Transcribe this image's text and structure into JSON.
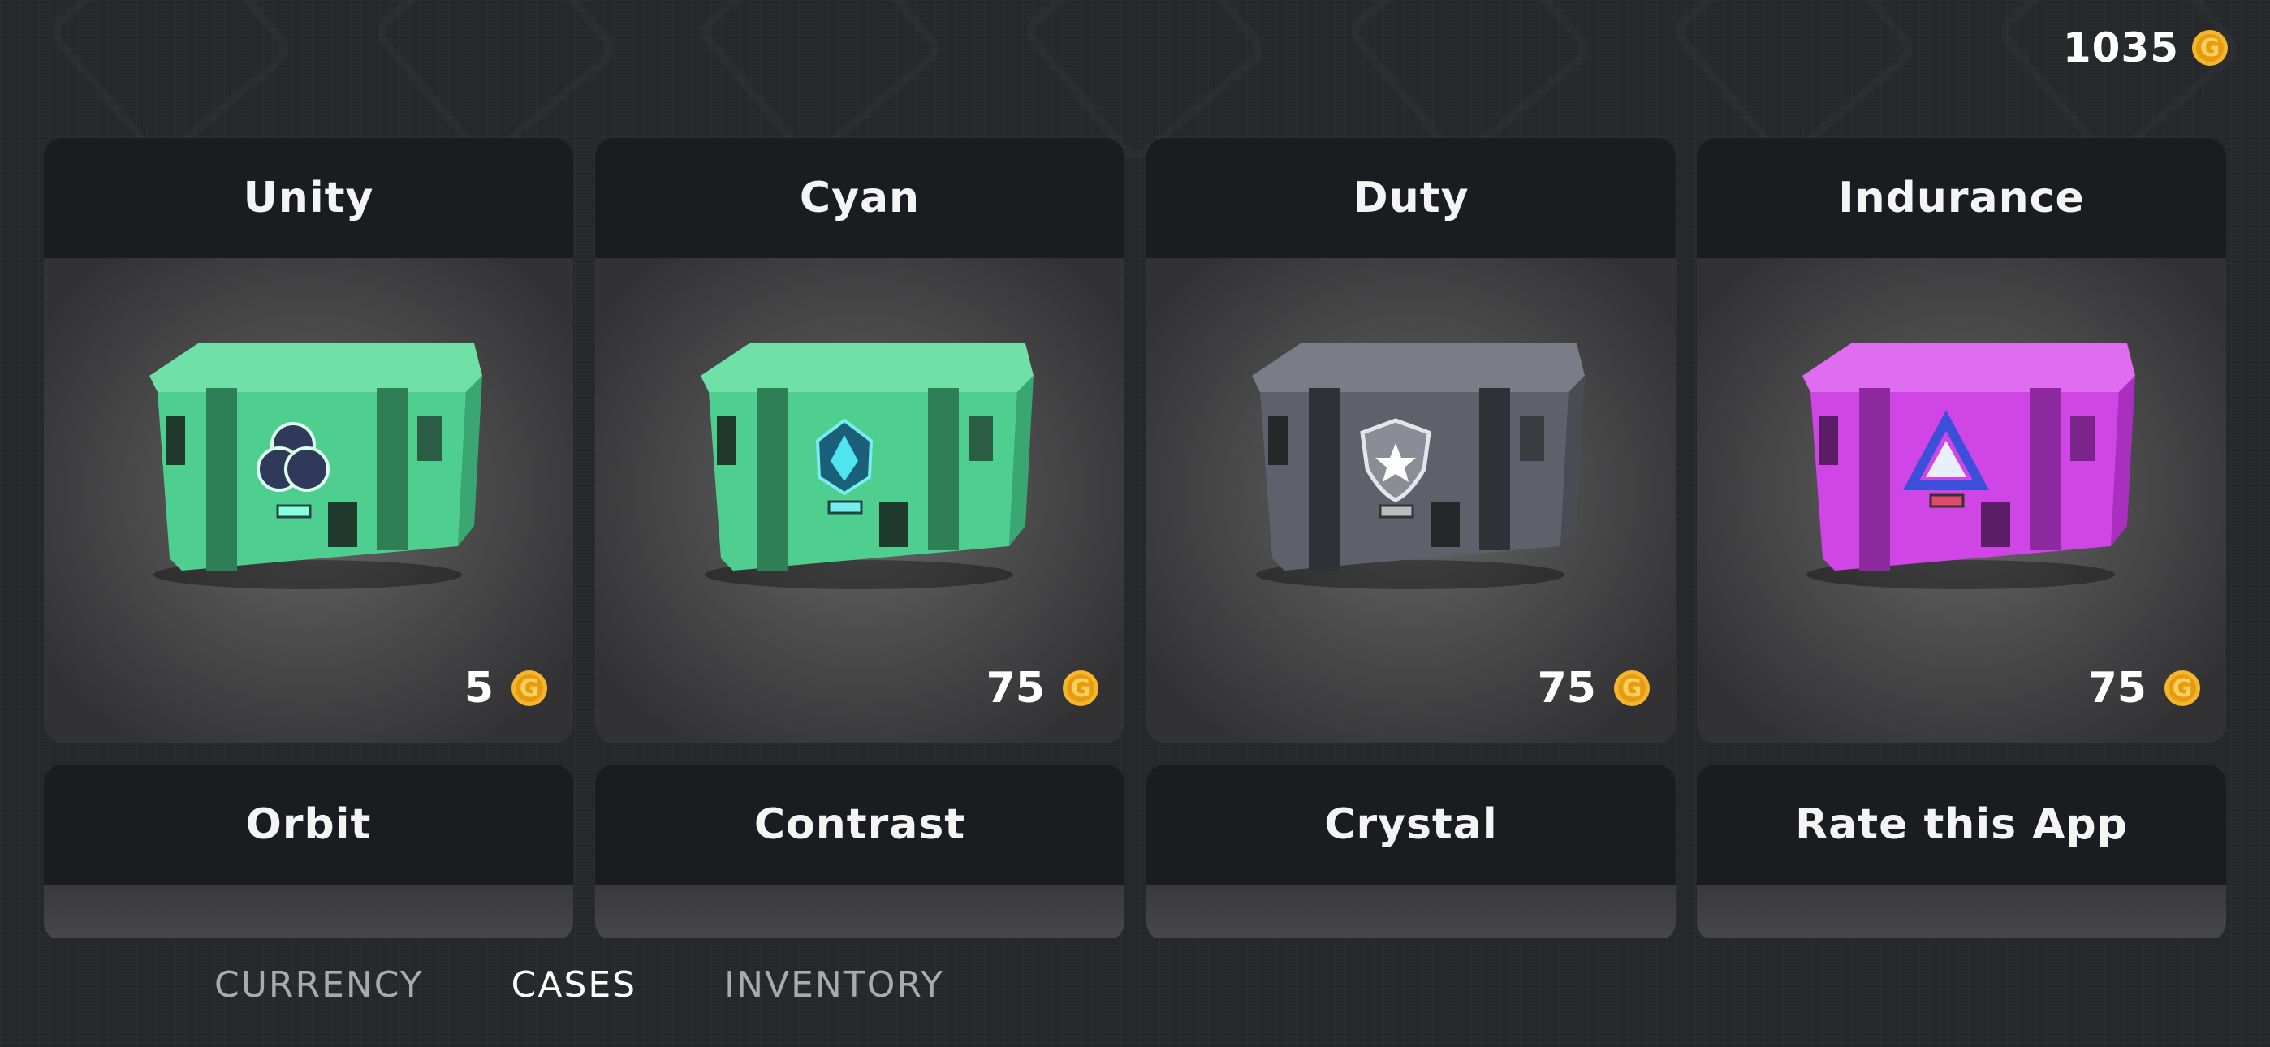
{
  "balance": {
    "amount": "1035",
    "icon": "coin-icon"
  },
  "colors": {
    "coin": "#f4b62a",
    "green_case": "#4fcf8f",
    "gray_case": "#5e616b",
    "magenta_case": "#cf45e6"
  },
  "cases": [
    {
      "name": "Unity",
      "price": "5",
      "color": "green",
      "emblem": "trefoil"
    },
    {
      "name": "Cyan",
      "price": "75",
      "color": "green",
      "emblem": "crystal"
    },
    {
      "name": "Duty",
      "price": "75",
      "color": "gray",
      "emblem": "shield"
    },
    {
      "name": "Indurance",
      "price": "75",
      "color": "magenta",
      "emblem": "triangle"
    },
    {
      "name": "Orbit"
    },
    {
      "name": "Contrast"
    },
    {
      "name": "Crystal"
    },
    {
      "name": "Rate this App"
    }
  ],
  "tabs": [
    {
      "label": "CURRENCY",
      "active": false
    },
    {
      "label": "CASES",
      "active": true
    },
    {
      "label": "INVENTORY",
      "active": false
    }
  ]
}
